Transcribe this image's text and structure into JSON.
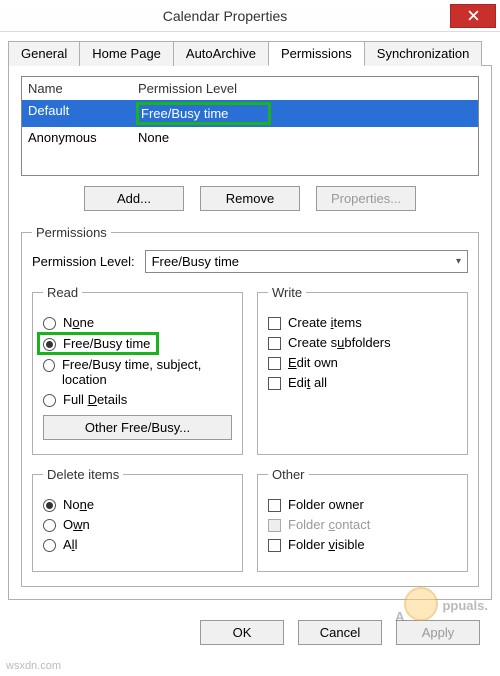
{
  "window": {
    "title": "Calendar Properties"
  },
  "tabs": [
    "General",
    "Home Page",
    "AutoArchive",
    "Permissions",
    "Synchronization"
  ],
  "tabs_active_index": 3,
  "list": {
    "headers": {
      "name": "Name",
      "level": "Permission Level"
    },
    "rows": [
      {
        "name": "Default",
        "level": "Free/Busy time",
        "selected": true
      },
      {
        "name": "Anonymous",
        "level": "None",
        "selected": false
      }
    ]
  },
  "list_buttons": {
    "add": "Add...",
    "remove": "Remove",
    "properties": "Properties..."
  },
  "permissions_legend": "Permissions",
  "permission_level_label": "Permission Level:",
  "permission_level_value": "Free/Busy time",
  "groups": {
    "read": {
      "legend": "Read",
      "options": [
        "None",
        "Free/Busy time",
        "Free/Busy time, subject, location",
        "Full Details"
      ],
      "checked_index": 1,
      "other_button": "Other Free/Busy..."
    },
    "write": {
      "legend": "Write",
      "options": [
        "Create items",
        "Create subfolders",
        "Edit own",
        "Edit all"
      ]
    },
    "delete": {
      "legend": "Delete items",
      "options": [
        "None",
        "Own",
        "All"
      ],
      "checked_index": 0
    },
    "other": {
      "legend": "Other",
      "options": [
        "Folder owner",
        "Folder contact",
        "Folder visible"
      ],
      "disabled_index": 1
    }
  },
  "dialog_buttons": {
    "ok": "OK",
    "cancel": "Cancel",
    "apply": "Apply"
  },
  "watermark": "ppuals.",
  "credit": "wsxdn.com"
}
